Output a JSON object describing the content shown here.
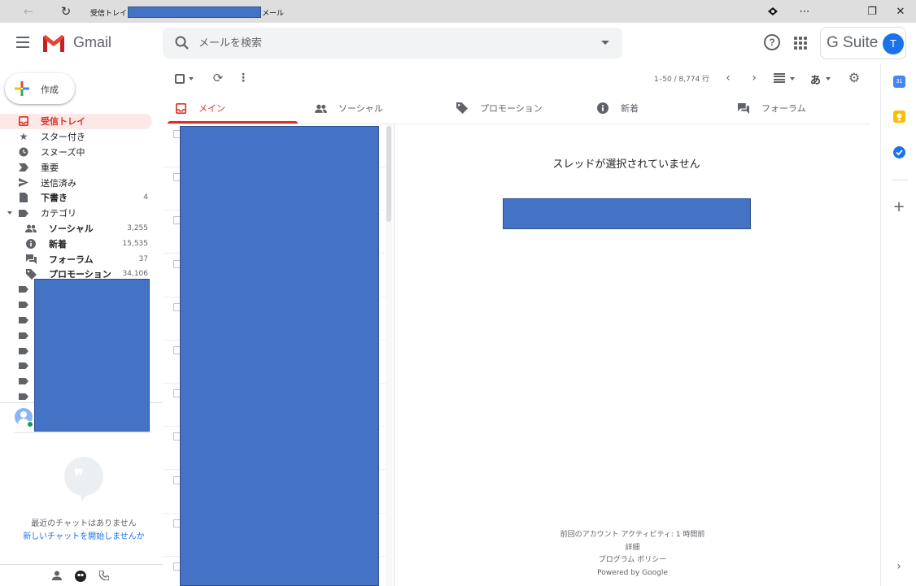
{
  "browser": {
    "title_prefix": "受信トレイ",
    "title_suffix": "メール",
    "back_icon": "←",
    "reload_icon": "↻",
    "menu_icon": "⋯",
    "restore_icon": "❐",
    "close_icon": "✕"
  },
  "header": {
    "app_name": "Gmail",
    "search_placeholder": "メールを検索",
    "help_glyph": "?",
    "gsuite_label": "G Suite",
    "avatar_initial": "T"
  },
  "sidebar": {
    "compose_label": "作成",
    "items": [
      {
        "label": "受信トレイ",
        "count": "",
        "icon": "inbox-icon"
      },
      {
        "label": "スター付き",
        "count": "",
        "icon": "star-icon"
      },
      {
        "label": "スヌーズ中",
        "count": "",
        "icon": "clock-icon"
      },
      {
        "label": "重要",
        "count": "",
        "icon": "important-icon"
      },
      {
        "label": "送信済み",
        "count": "",
        "icon": "send-icon"
      },
      {
        "label": "下書き",
        "count": "4",
        "icon": "draft-icon"
      },
      {
        "label": "カテゴリ",
        "count": "",
        "icon": "label-icon"
      }
    ],
    "categories": [
      {
        "label": "ソーシャル",
        "count": "3,255",
        "icon": "people-icon"
      },
      {
        "label": "新着",
        "count": "15,535",
        "icon": "info-icon"
      },
      {
        "label": "フォーラム",
        "count": "37",
        "icon": "forum-icon"
      },
      {
        "label": "プロモーション",
        "count": "34,106",
        "icon": "tag-icon"
      }
    ],
    "chat": {
      "empty_text": "最近のチャットはありません",
      "start_link": "新しいチャットを開始しませんか"
    }
  },
  "toolbar": {
    "pager_text": "1–50 / 8,774 行",
    "ime_label": "あ"
  },
  "tabs": [
    {
      "label": "メイン",
      "icon": "inbox-icon",
      "active": true
    },
    {
      "label": "ソーシャル",
      "icon": "people-icon",
      "active": false
    },
    {
      "label": "プロモーション",
      "icon": "tag-icon",
      "active": false
    },
    {
      "label": "新着",
      "icon": "info-icon",
      "active": false
    },
    {
      "label": "フォーラム",
      "icon": "forum-icon",
      "active": false
    }
  ],
  "reading_pane": {
    "no_thread": "スレッドが選択されていません",
    "footer": {
      "activity": "前回のアカウント アクティビティ: 1 時間前",
      "details": "詳細",
      "policy": "プログラム ポリシー",
      "powered": "Powered by Google"
    }
  },
  "addons": {
    "calendar_label": "31"
  },
  "colors": {
    "accent": "#d93025",
    "link": "#1a73e8",
    "redaction": "#4472c4"
  }
}
